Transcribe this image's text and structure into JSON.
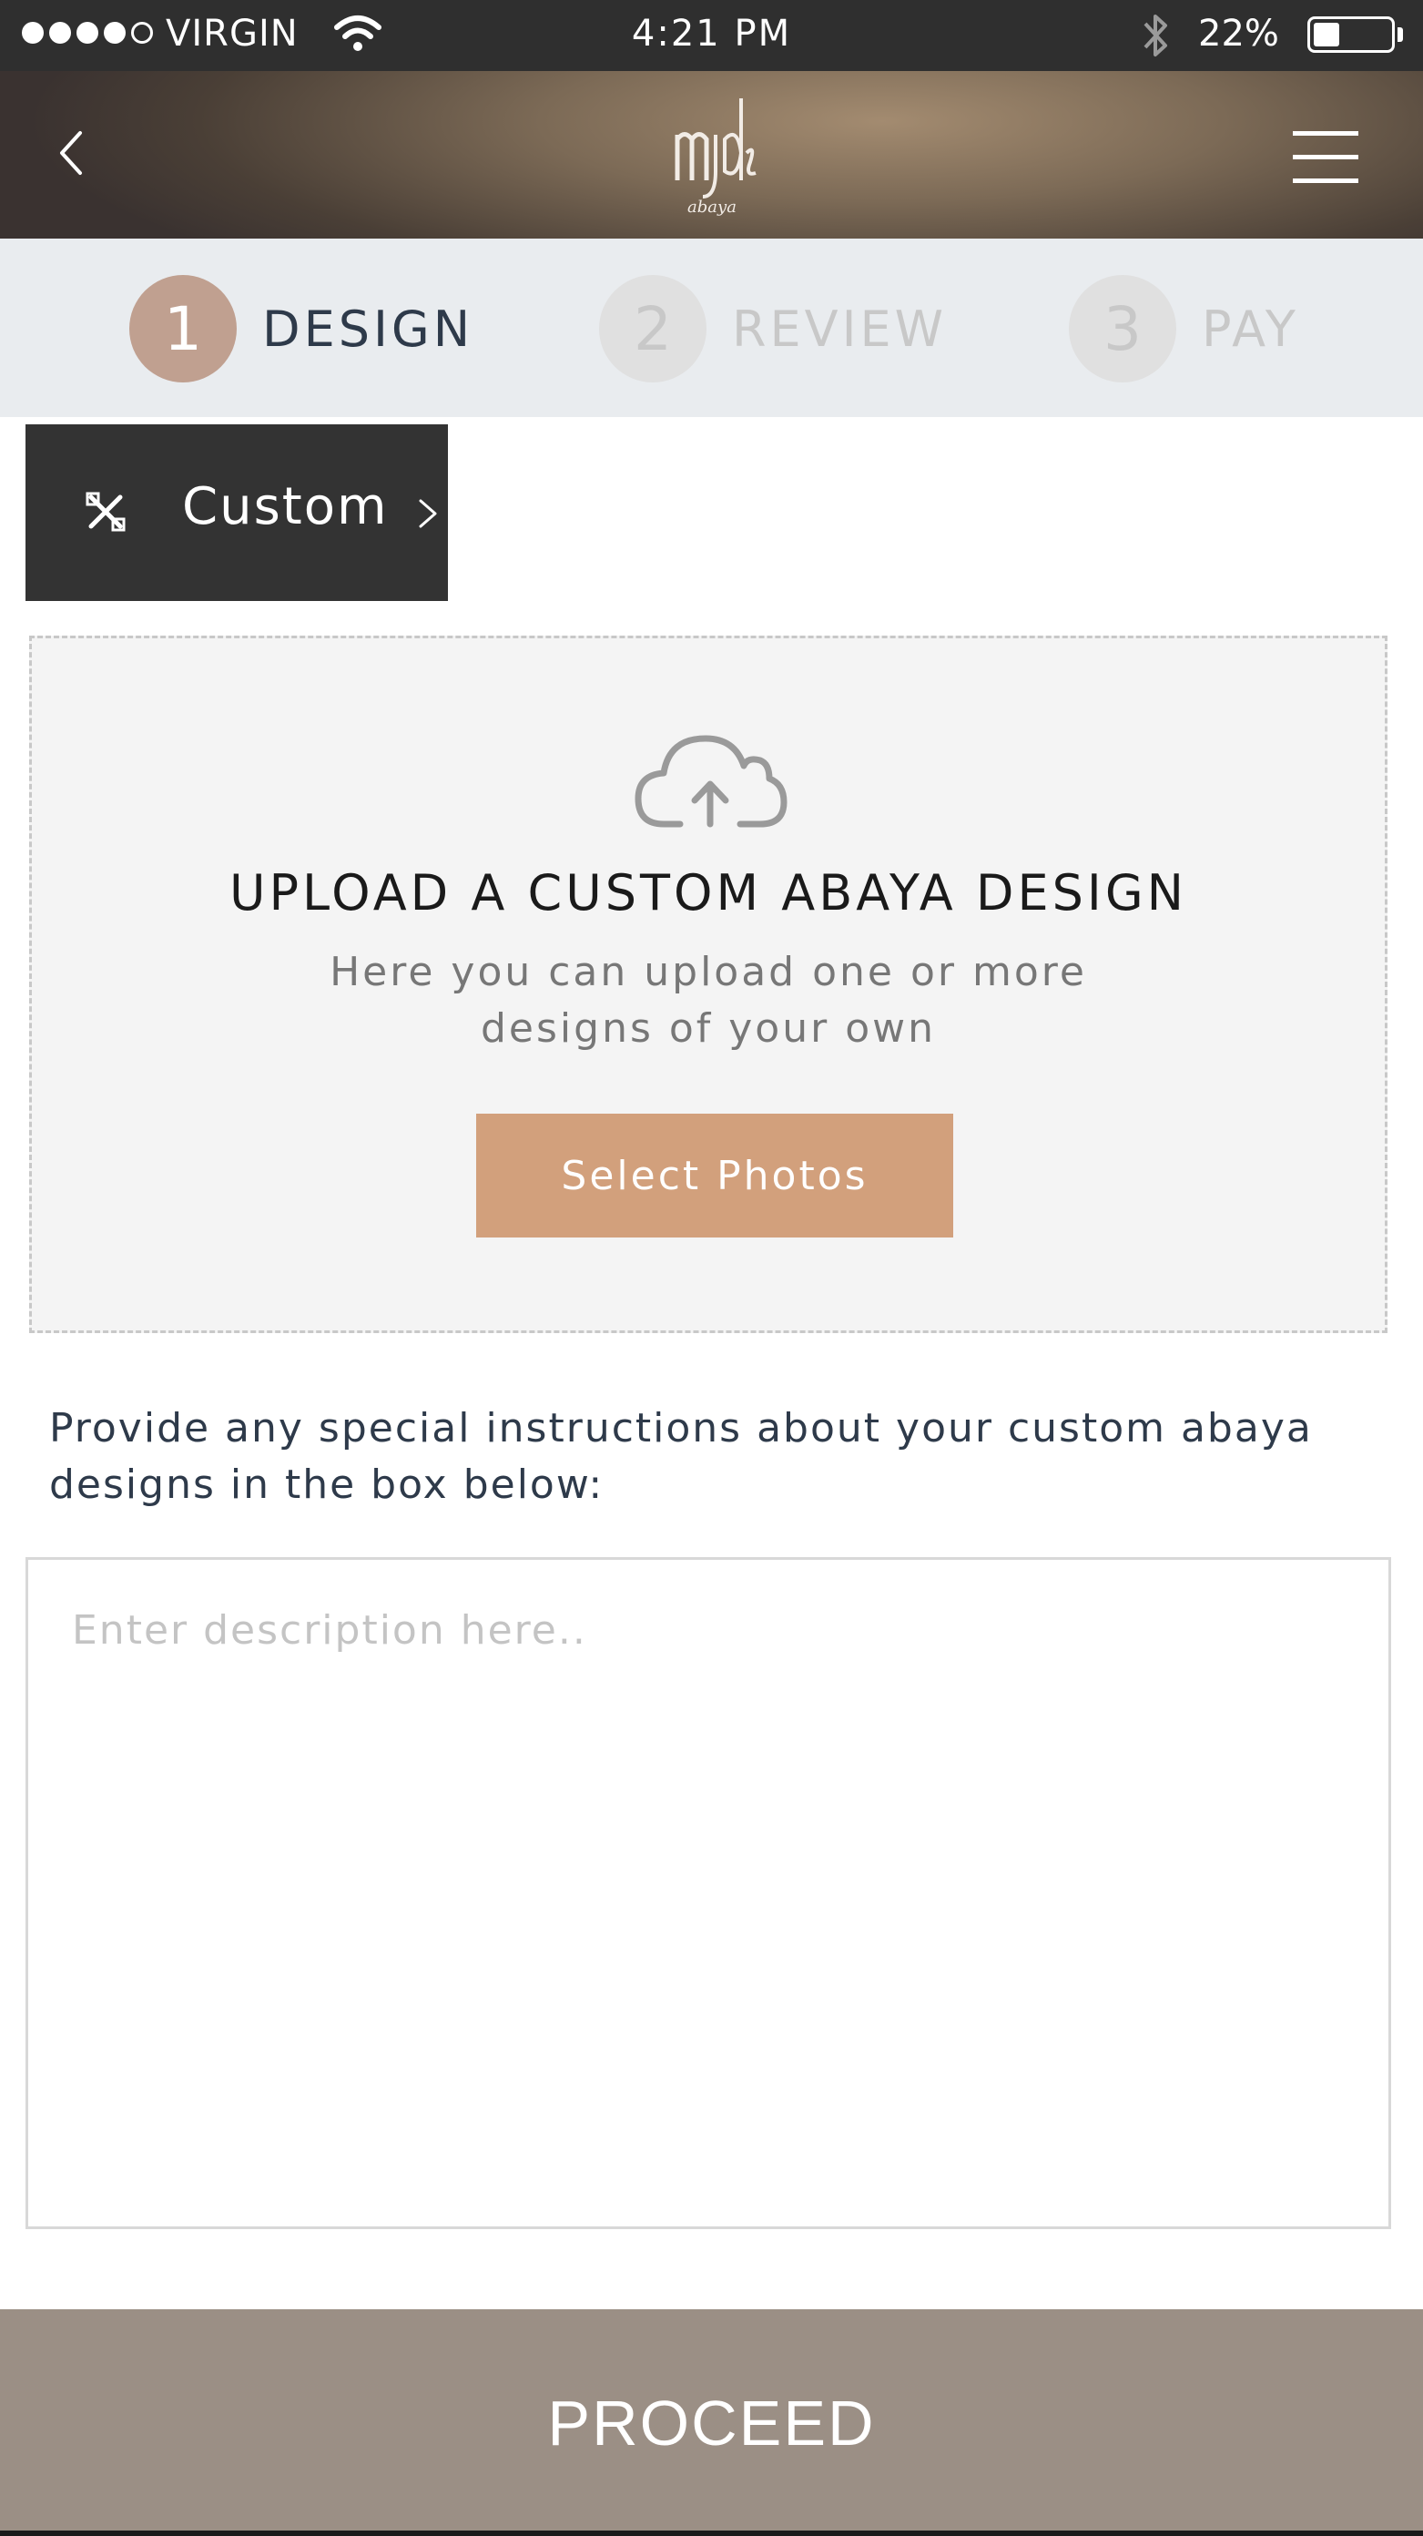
{
  "status_bar": {
    "carrier": "VIRGIN",
    "time": "4:21 PM",
    "battery_percent": "22%",
    "signal_bars_filled": 4,
    "signal_bars_total": 5,
    "battery_level": 0.22
  },
  "header": {
    "logo_sub": "abaya",
    "back_icon": "chevron-left-icon",
    "menu_icon": "hamburger-menu-icon"
  },
  "steps": [
    {
      "number": "1",
      "label": "DESIGN",
      "active": true
    },
    {
      "number": "2",
      "label": "REVIEW",
      "active": false
    },
    {
      "number": "3",
      "label": "PAY",
      "active": false
    }
  ],
  "custom_tab": {
    "label": "Custom",
    "icon": "tools-icon"
  },
  "upload": {
    "icon": "cloud-upload-icon",
    "title": "UPLOAD A CUSTOM ABAYA DESIGN",
    "subtitle_line1": "Here you can upload one or more",
    "subtitle_line2": "designs of your own",
    "button_label": "Select Photos"
  },
  "instructions": {
    "text_line1": "Provide any special instructions about your custom abaya",
    "text_line2": "designs in the box below:",
    "placeholder": "Enter description here..",
    "value": ""
  },
  "footer": {
    "proceed_label": "PROCEED"
  },
  "colors": {
    "accent": "#d2a07c",
    "active_step": "#c0a090",
    "proceed": "#9b8f85",
    "dark_tab": "#333333"
  }
}
